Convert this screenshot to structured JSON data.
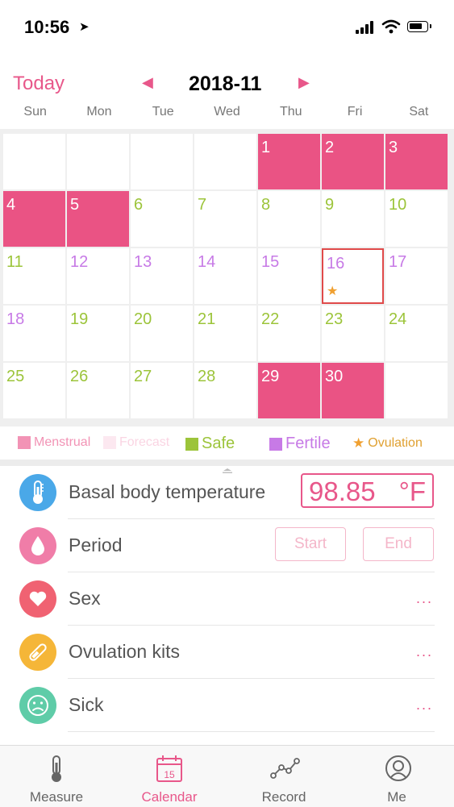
{
  "status_bar": {
    "time": "10:56",
    "location_icon": "location-arrow-icon",
    "signal_icon": "cellular-signal-icon",
    "wifi_icon": "wifi-icon",
    "battery_icon": "battery-icon"
  },
  "header": {
    "today_label": "Today",
    "month": "2018-11",
    "prev_icon": "triangle-left-icon",
    "next_icon": "triangle-right-icon"
  },
  "weekdays": [
    "Sun",
    "Mon",
    "Tue",
    "Wed",
    "Thu",
    "Fri",
    "Sat"
  ],
  "calendar": {
    "days": [
      {
        "n": ""
      },
      {
        "n": ""
      },
      {
        "n": ""
      },
      {
        "n": ""
      },
      {
        "n": "1",
        "t": "menstrual"
      },
      {
        "n": "2",
        "t": "menstrual"
      },
      {
        "n": "3",
        "t": "menstrual"
      },
      {
        "n": "4",
        "t": "menstrual"
      },
      {
        "n": "5",
        "t": "menstrual"
      },
      {
        "n": "6",
        "t": "safe"
      },
      {
        "n": "7",
        "t": "safe"
      },
      {
        "n": "8",
        "t": "safe"
      },
      {
        "n": "9",
        "t": "safe"
      },
      {
        "n": "10",
        "t": "safe"
      },
      {
        "n": "11",
        "t": "safe"
      },
      {
        "n": "12",
        "t": "fertile"
      },
      {
        "n": "13",
        "t": "fertile"
      },
      {
        "n": "14",
        "t": "fertile"
      },
      {
        "n": "15",
        "t": "fertile"
      },
      {
        "n": "16",
        "t": "fertile",
        "today": true,
        "ovulation": true
      },
      {
        "n": "17",
        "t": "fertile"
      },
      {
        "n": "18",
        "t": "fertile"
      },
      {
        "n": "19",
        "t": "safe"
      },
      {
        "n": "20",
        "t": "safe"
      },
      {
        "n": "21",
        "t": "safe"
      },
      {
        "n": "22",
        "t": "safe"
      },
      {
        "n": "23",
        "t": "safe"
      },
      {
        "n": "24",
        "t": "safe"
      },
      {
        "n": "25",
        "t": "safe"
      },
      {
        "n": "26",
        "t": "safe"
      },
      {
        "n": "27",
        "t": "safe"
      },
      {
        "n": "28",
        "t": "safe"
      },
      {
        "n": "29",
        "t": "menstrual"
      },
      {
        "n": "30",
        "t": "menstrual"
      },
      {
        "n": ""
      }
    ]
  },
  "legend": {
    "menstrual": "Menstrual",
    "forecast": "Forecast",
    "safe": "Safe",
    "fertile": "Fertile",
    "ovulation": "Ovulation",
    "colors": {
      "menstrual": "#ea5384",
      "safe": "#9cc43a",
      "fertile": "#c77ae6",
      "ovulation": "#f0a030"
    }
  },
  "records": {
    "temperature": {
      "label": "Basal body temperature",
      "value": "98.85",
      "unit": "°F",
      "icon": "thermometer-icon"
    },
    "period": {
      "label": "Period",
      "start_label": "Start",
      "end_label": "End",
      "icon": "droplet-icon"
    },
    "sex": {
      "label": "Sex",
      "more": "...",
      "icon": "heart-icon"
    },
    "ovulation_kits": {
      "label": "Ovulation kits",
      "more": "...",
      "icon": "test-strip-icon"
    },
    "sick": {
      "label": "Sick",
      "more": "...",
      "icon": "sad-face-icon"
    }
  },
  "tabs": [
    {
      "label": "Measure",
      "icon": "thermometer-icon",
      "active": false
    },
    {
      "label": "Calendar",
      "icon": "calendar-icon",
      "active": true,
      "date_badge": "15"
    },
    {
      "label": "Record",
      "icon": "graph-nodes-icon",
      "active": false
    },
    {
      "label": "Me",
      "icon": "person-icon",
      "active": false
    }
  ],
  "accent_color": "#e8578a"
}
